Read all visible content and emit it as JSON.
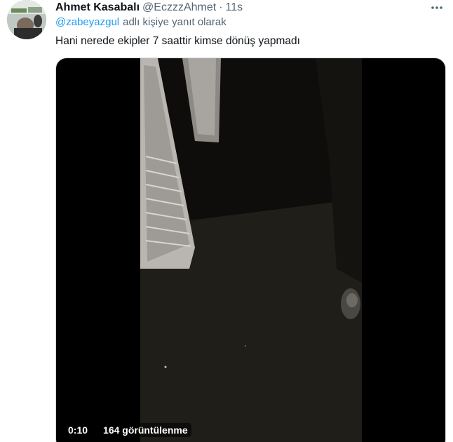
{
  "tweet": {
    "author_name": "Ahmet Kasabalı",
    "author_handle": "@EczzzAhmet",
    "separator": "·",
    "timestamp": "11s",
    "reply_to_handle": "@zabeyazgul",
    "reply_to_suffix": "adlı kişiye yanıt olarak",
    "text": "Hani nerede ekipler 7 saattir kimse dönüş yapmadı",
    "more_icon": "more-horizontal-icon"
  },
  "video": {
    "duration": "0:10",
    "views": "164 görüntülenme"
  },
  "colors": {
    "text_primary": "#0f1419",
    "text_secondary": "#536471",
    "link": "#1d9bf0",
    "media_background": "#000000"
  }
}
